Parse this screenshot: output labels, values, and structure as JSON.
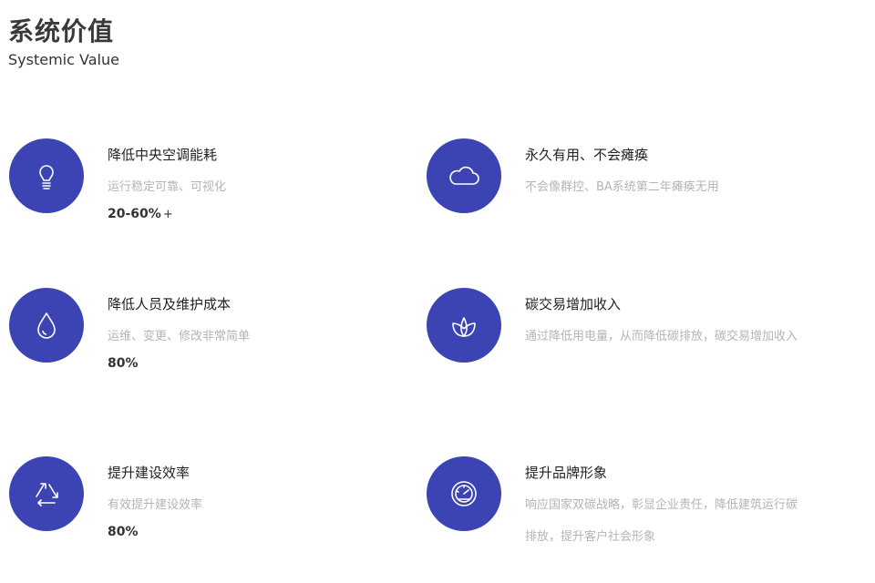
{
  "header": {
    "title": "系统价值",
    "subtitle": "Systemic Value"
  },
  "colors": {
    "accent": "#3c43b3",
    "title": "#3a3a3a",
    "muted": "#b4b4b4"
  },
  "items": [
    {
      "icon": "lightbulb-icon",
      "title": "降低中央空调能耗",
      "desc": "运行稳定可靠、可视化",
      "value": "20-60%",
      "suffix": "+"
    },
    {
      "icon": "cloud-icon",
      "title": "永久有用、不会瘫痪",
      "desc": "不会像群控、BA系统第二年瘫痪无用",
      "value": "",
      "suffix": ""
    },
    {
      "icon": "water-drop-icon",
      "title": "降低人员及维护成本",
      "desc": "运维、变更、修改非常简单",
      "value": "80%",
      "suffix": ""
    },
    {
      "icon": "leaf-icon",
      "title": "碳交易增加收入",
      "desc": "通过降低用电量，从而降低碳排放，碳交易增加收入",
      "value": "",
      "suffix": ""
    },
    {
      "icon": "recycle-icon",
      "title": "提升建设效率",
      "desc": "有效提升建设效率",
      "value": "80%",
      "suffix": ""
    },
    {
      "icon": "gauge-icon",
      "title": "提升品牌形象",
      "desc": "响应国家双碳战略，彰显企业责任，降低建筑运行碳排放，提升客户社会形象",
      "value": "",
      "suffix": ""
    }
  ]
}
